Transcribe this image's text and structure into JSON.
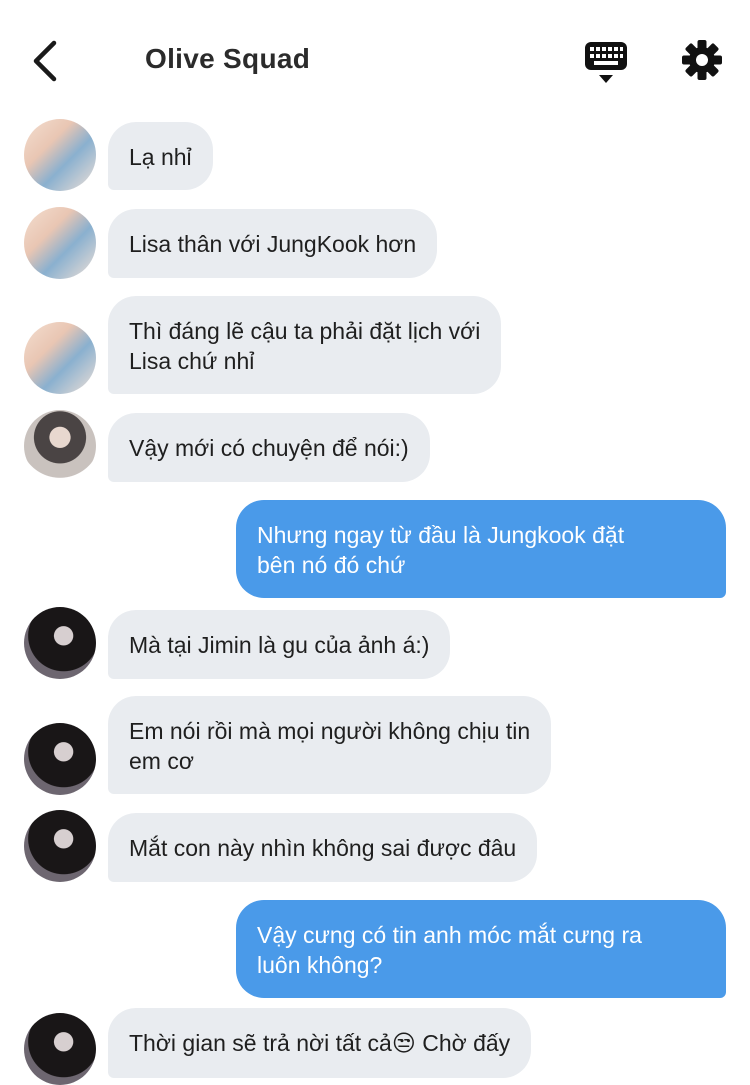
{
  "header": {
    "title": "Olive Squad"
  },
  "icons": {
    "back": "chevron-left-icon",
    "keyboard": "keyboard-icon",
    "settings": "gear-icon"
  },
  "colors": {
    "incoming_bubble": "#e9ecf0",
    "outgoing_bubble": "#4a9ae9",
    "outgoing_text": "#ffffff",
    "title_text": "#2b2b2b"
  },
  "messages": [
    {
      "side": "incoming",
      "text": "Lạ nhỉ"
    },
    {
      "side": "incoming",
      "text": "Lisa thân với JungKook hơn"
    },
    {
      "side": "incoming",
      "text": "Thì đáng lẽ cậu ta phải đặt lịch với\nLisa chứ nhỉ"
    },
    {
      "side": "incoming",
      "text": "Vậy mới có chuyện để nói:)"
    },
    {
      "side": "outgoing",
      "text": "Nhưng ngay từ đầu là Jungkook đặt\nbên nó đó chứ"
    },
    {
      "side": "incoming",
      "text": "Mà tại Jimin là gu của ảnh á:)"
    },
    {
      "side": "incoming",
      "text": "Em nói rồi mà mọi người không chịu tin\nem cơ"
    },
    {
      "side": "incoming",
      "text": "Mắt con này nhìn không sai được đâu"
    },
    {
      "side": "outgoing",
      "text": "Vậy cưng có tin anh móc mắt cưng ra\nluôn không?"
    },
    {
      "side": "incoming",
      "text": "Thời gian sẽ trả nời tất cả😒 Chờ đấy"
    }
  ]
}
